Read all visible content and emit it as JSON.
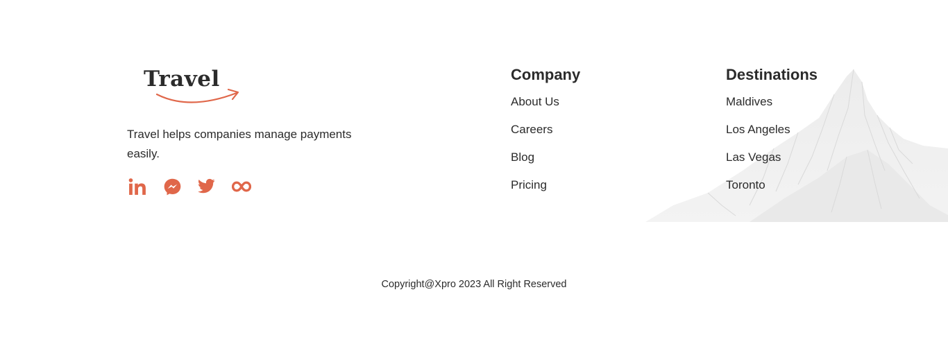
{
  "brand": {
    "logo_text": "Travel",
    "tagline": "Travel helps companies manage payments easily.",
    "accent_color": "#e0674a"
  },
  "social": [
    {
      "icon": "linkedin-icon"
    },
    {
      "icon": "messenger-icon"
    },
    {
      "icon": "twitter-icon"
    },
    {
      "icon": "infinity-icon"
    }
  ],
  "company": {
    "heading": "Company",
    "links": [
      "About Us",
      "Careers",
      "Blog",
      "Pricing"
    ]
  },
  "destinations": {
    "heading": "Destinations",
    "links": [
      "Maldives",
      "Los Angeles",
      "Las Vegas",
      "Toronto"
    ]
  },
  "copyright": "Copyright@Xpro 2023 All Right Reserved"
}
